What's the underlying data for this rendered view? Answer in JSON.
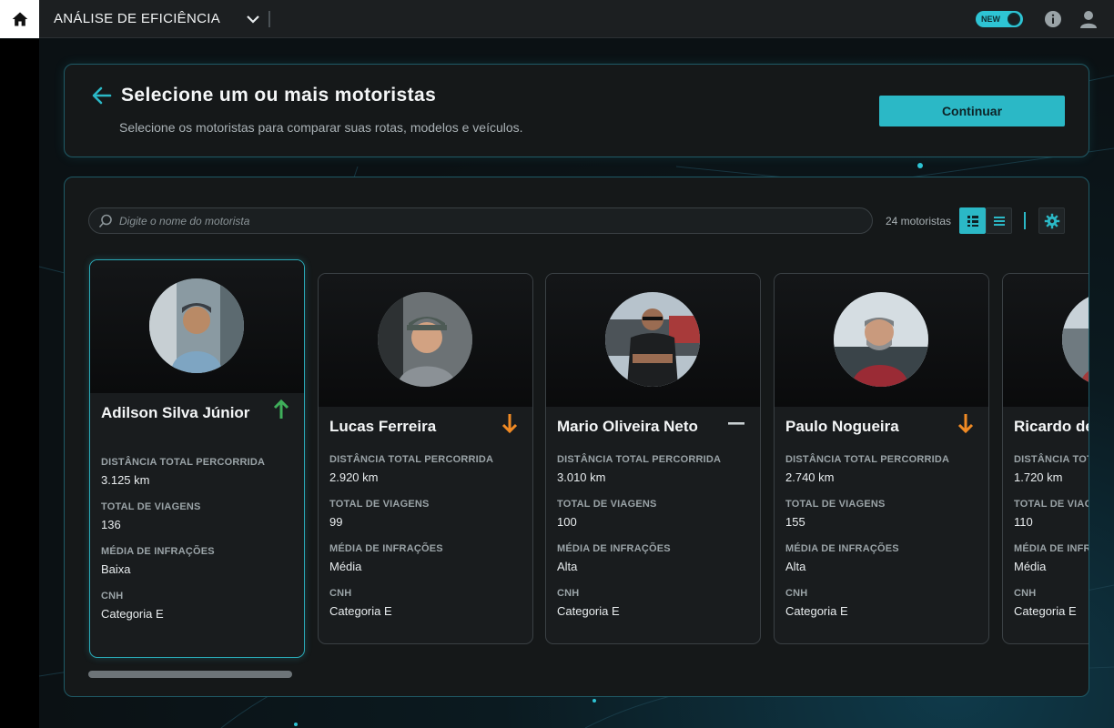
{
  "header": {
    "title": "ANÁLISE DE EFICIÊNCIA",
    "new_toggle_label": "NEW"
  },
  "panel": {
    "heading": "Selecione um ou mais motoristas",
    "subtitle": "Selecione os motoristas para comparar suas rotas, modelos e veículos.",
    "continue_label": "Continuar"
  },
  "toolbar": {
    "search_placeholder": "Digite o nome do motorista",
    "search_value": "",
    "count_text": "24 motoristas",
    "active_view": "grid"
  },
  "stat_labels": {
    "distance": "DISTÂNCIA TOTAL PERCORRIDA",
    "trips": "TOTAL DE VIAGENS",
    "infractions": "MÉDIA DE INFRAÇÕES",
    "license": "CNH"
  },
  "drivers": [
    {
      "name": "Adilson Silva Júnior",
      "trend": "up",
      "distance": "3.125 km",
      "trips": "136",
      "infractions": "Baixa",
      "license": "Categoria E",
      "selected": true
    },
    {
      "name": "Lucas Ferreira",
      "trend": "down",
      "distance": "2.920 km",
      "trips": "99",
      "infractions": "Média",
      "license": "Categoria E",
      "selected": false
    },
    {
      "name": "Mario Oliveira Neto",
      "trend": "neutral",
      "distance": "3.010 km",
      "trips": "100",
      "infractions": "Alta",
      "license": "Categoria E",
      "selected": false
    },
    {
      "name": "Paulo Nogueira",
      "trend": "down",
      "distance": "2.740 km",
      "trips": "155",
      "infractions": "Alta",
      "license": "Categoria E",
      "selected": false
    },
    {
      "name": "Ricardo de",
      "trend": "none",
      "distance": "1.720 km",
      "trips": "110",
      "infractions": "Média",
      "license": "Categoria E",
      "selected": false
    }
  ],
  "colors": {
    "accent": "#2bb8c6",
    "trend_up": "#3fae5a",
    "trend_down": "#f08a24",
    "trend_neutral": "#c9cfd2"
  }
}
